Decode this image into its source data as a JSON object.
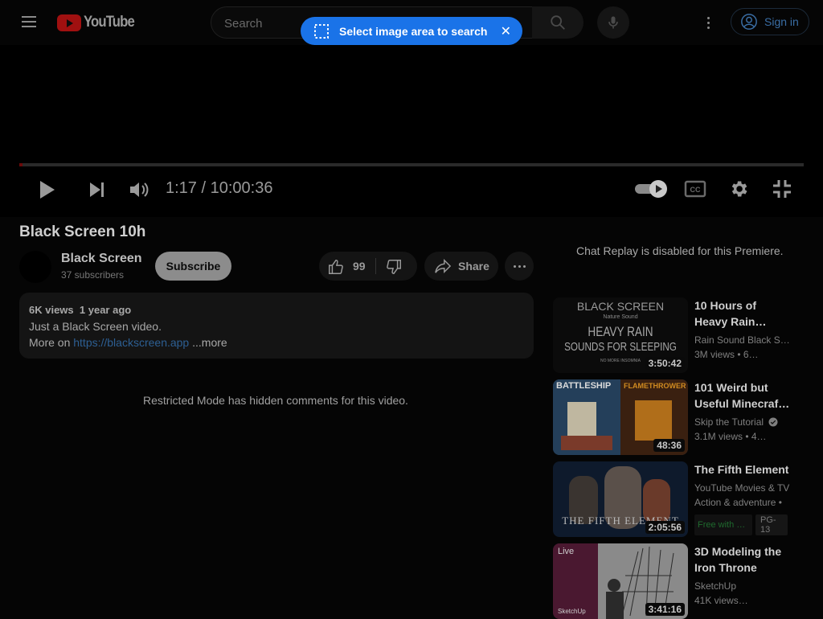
{
  "header": {
    "logo_text": "YouTube",
    "search_placeholder": "Search",
    "sign_in": "Sign in"
  },
  "lens_pill": {
    "label": "Select image area to search",
    "close": "✕"
  },
  "player": {
    "time": "1:17 / 10:00:36",
    "progress_fraction": 0.0021,
    "autoplay_on": true
  },
  "video": {
    "title": "Black Screen 10h",
    "channel": "Black Screen",
    "subscribers": "37 subscribers",
    "subscribe": "Subscribe",
    "likes": "99",
    "share": "Share",
    "views": "6K views",
    "age": "1 year ago",
    "desc_line1": "Just a Black Screen video.",
    "desc_line2_prefix": "More on",
    "desc_link": "https://blackscreen.app",
    "more": "...more"
  },
  "comments": {
    "restricted": "Restricted Mode has hidden comments for this video."
  },
  "sidebar": {
    "chat_replay": "Chat Replay is disabled for this Premiere.",
    "items": [
      {
        "title_line1": "10 Hours of",
        "title_line2": "Heavy Rain…",
        "channel": "Rain Sound Black S…",
        "meta": "3M views  • 6…",
        "duration": "3:50:42",
        "thumb_text1": "BLACK SCREEN",
        "thumb_text2": "Nature Sound",
        "thumb_text3": "HEAVY RAIN",
        "thumb_text4": "SOUNDS FOR SLEEPING",
        "thumb_text5": "NO MORE INSOMNIA"
      },
      {
        "title_line1": "101 Weird but",
        "title_line2": "Useful Minecraf…",
        "channel": "Skip the Tutorial",
        "meta": "3.1M views  • 4…",
        "duration": "48:36",
        "thumb_text1": "BATTLESHIP",
        "thumb_text2": "FLAMETHROWER"
      },
      {
        "title_line1": "The Fifth Element",
        "channel": "YouTube Movies & TV",
        "meta": "Action & adventure •",
        "badge_free": "Free with …",
        "badge_rating": "PG-13",
        "duration": "2:05:56",
        "thumb_text1": "THE FIFTH ELEMENT"
      },
      {
        "title_line1": "3D Modeling the",
        "title_line2": "Iron Throne",
        "channel": "SketchUp",
        "meta": "41K views…",
        "duration": "3:41:16",
        "thumb_text1": "Live",
        "thumb_text2": "SketchUp"
      }
    ]
  },
  "icons": {
    "menu": "menu-icon",
    "search": "search-icon",
    "mic": "mic-icon",
    "more": "more-vert-icon",
    "account": "account-circle-icon",
    "play": "play-icon",
    "next": "skip-next-icon",
    "volume": "volume-icon",
    "captions": "closed-captions-icon",
    "settings": "gear-icon",
    "fullscreen_exit": "fullscreen-exit-icon",
    "like": "thumb-up-icon",
    "dislike": "thumb-down-icon",
    "share": "share-icon",
    "verified": "verified-icon"
  },
  "colors": {
    "accent_blue": "#1a73e8",
    "youtube_red": "#a01010",
    "link_blue": "#2d5f93"
  }
}
